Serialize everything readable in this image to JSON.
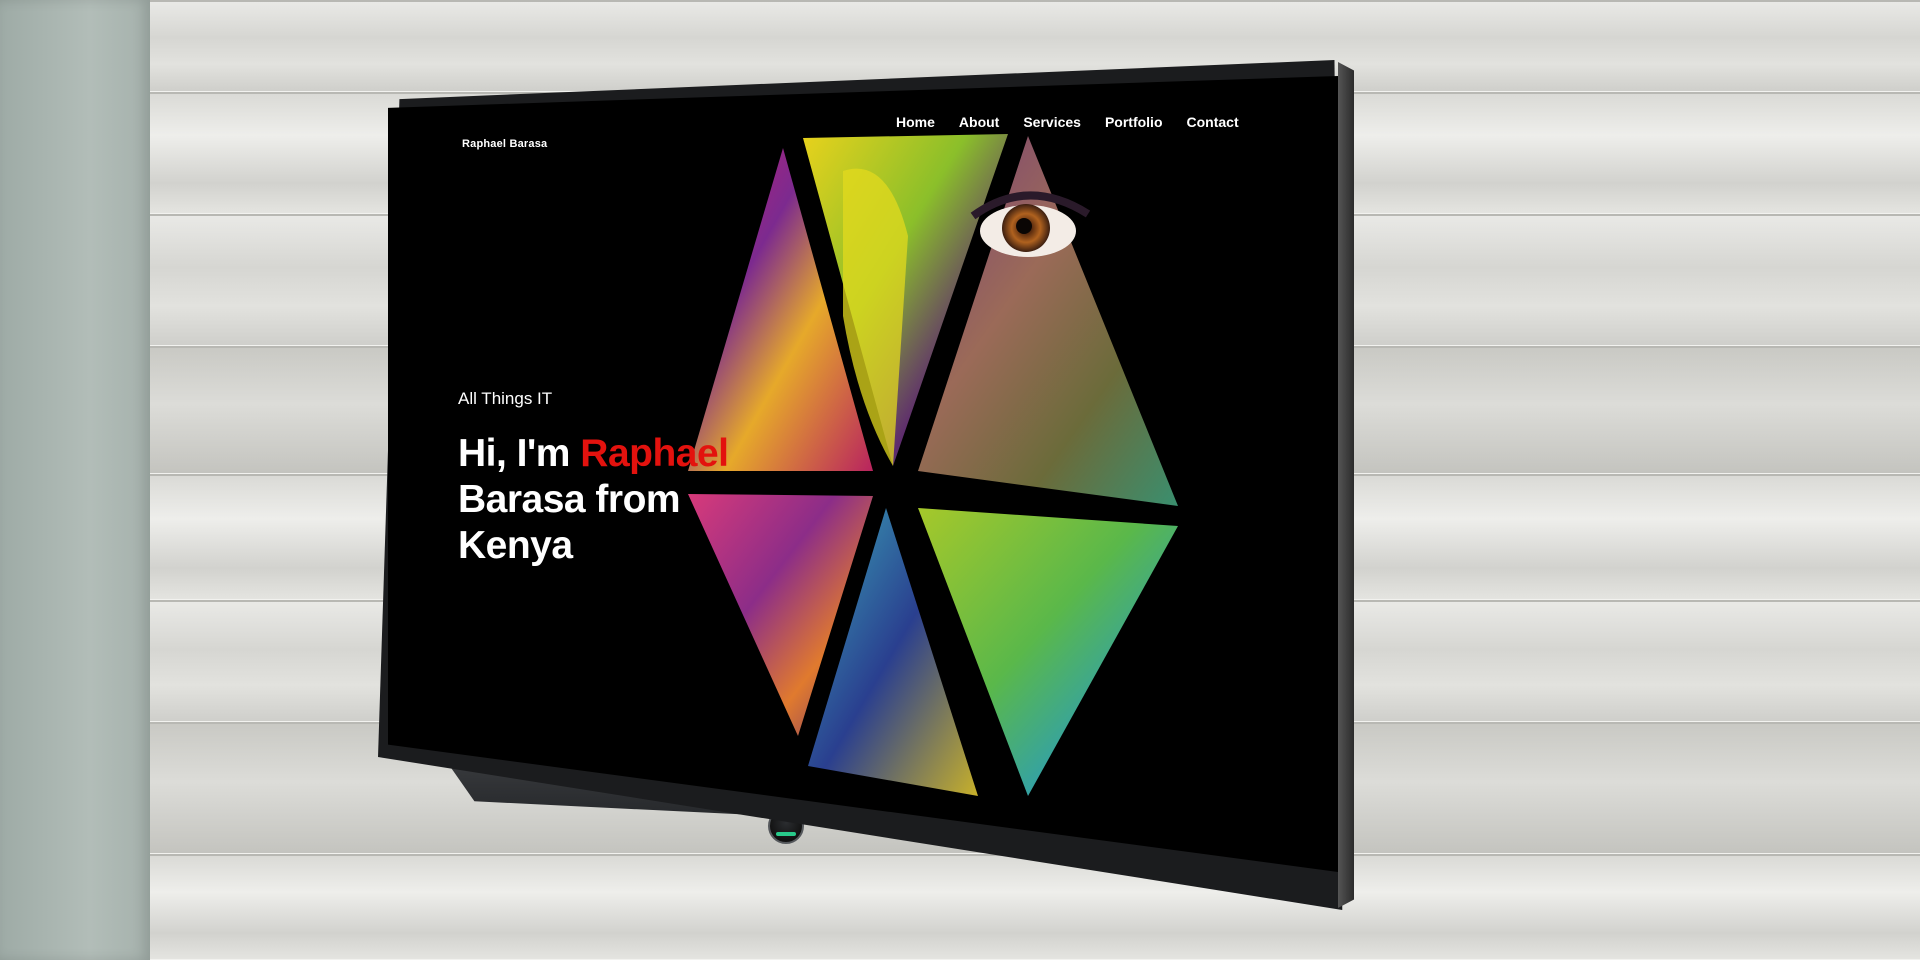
{
  "site": {
    "logo": "Raphael Barasa",
    "nav": {
      "home": "Home",
      "about": "About",
      "services": "Services",
      "portfolio": "Portfolio",
      "contact": "Contact"
    },
    "tagline": "All Things IT",
    "headline": {
      "prefix": "Hi, I'm ",
      "highlight": "Raphael",
      "suffix": "Barasa from Kenya"
    },
    "colors": {
      "background": "#000000",
      "text": "#ffffff",
      "highlight": "#e3120e"
    }
  },
  "scene": {
    "device": "wall-mounted TV",
    "indicator_color": "#28c98a"
  }
}
